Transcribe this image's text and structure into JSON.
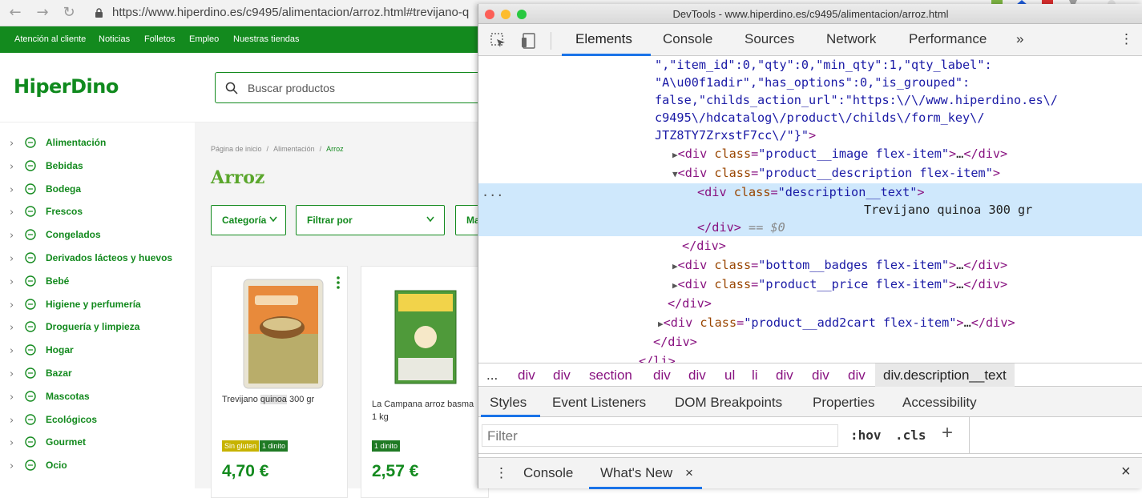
{
  "browser": {
    "url": "https://www.hiperdino.es/c9495/alimentacion/arroz.html#trevijano-q"
  },
  "site": {
    "topnav": [
      "Atención al cliente",
      "Noticias",
      "Folletos",
      "Empleo",
      "Nuestras tiendas"
    ],
    "logo": "HiperDino",
    "search_placeholder": "Buscar productos",
    "sidebar": [
      "Alimentación",
      "Bebidas",
      "Bodega",
      "Frescos",
      "Congelados",
      "Derivados lácteos y huevos",
      "Bebé",
      "Higiene y perfumería",
      "Droguería y limpieza",
      "Hogar",
      "Bazar",
      "Mascotas",
      "Ecológicos",
      "Gourmet",
      "Ocio"
    ],
    "breadcrumb": {
      "home": "Página de inicio",
      "sep": "/",
      "cat": "Alimentación",
      "current": "Arroz"
    },
    "page_title": "Arroz",
    "filters": {
      "categoria": "Categoría",
      "filtrar": "Filtrar por",
      "mas": "Ma"
    },
    "products": [
      {
        "name_pre": "Trevijano ",
        "name_hl": "quinoa",
        "name_post": " 300 gr",
        "badge1": "Sin gluten",
        "badge2": "1 dinito",
        "price": "4,70 €"
      },
      {
        "name_line1": "La Campana arroz basma",
        "name_line2": "1 kg",
        "badge1": "1 dinito",
        "price": "2,57 €"
      }
    ],
    "colors": {
      "brand_green": "#138a1e",
      "title_green": "#5aa62c",
      "badge_yellow": "#c7b300",
      "badge_green": "#1f7a24"
    }
  },
  "devtools": {
    "window_title": "DevTools - www.hiperdino.es/c9495/alimentacion/arroz.html",
    "tabs": [
      "Elements",
      "Console",
      "Sources",
      "Network",
      "Performance"
    ],
    "more_tabs": "»",
    "code": {
      "l1": "\",\"item_id\":0,\"qty\":0,\"min_qty\":1,\"qty_label\":",
      "l2": "\"A\\u00f1adir\",\"has_options\":0,\"is_grouped\":",
      "l3": "false,\"childs_action_url\":\"https:\\/\\/www.hiperdino.es\\/",
      "l4": "c9495\\/hdcatalog\\/product\\/childs\\/form_key\\/",
      "l5a": "JTZ8TY7ZrxstF7cc\\/\"}\"",
      "l5b": ">",
      "div": "div",
      "class": "class",
      "c_image": "\"product__image flex-item\"",
      "c_desc": "\"product__description flex-item\"",
      "c_text": "\"description__text\"",
      "text_node": "Trevijano quinoa 300 gr",
      "eq": "== $0",
      "c_badges": "\"bottom__badges flex-item\"",
      "c_price": "\"product__price flex-item\"",
      "c_add": "\"product__add2cart flex-item\"",
      "ellipsis": "…",
      "li": "li"
    },
    "crumbs": [
      "...",
      "div",
      "div",
      "section",
      "div",
      "div",
      "ul",
      "li",
      "div",
      "div",
      "div",
      "div.description__text"
    ],
    "subtabs": [
      "Styles",
      "Event Listeners",
      "DOM Breakpoints",
      "Properties",
      "Accessibility"
    ],
    "filter_placeholder": "Filter",
    "hov": ":hov",
    "cls": ".cls",
    "plus": "+",
    "drawer_tabs": [
      "Console",
      "What's New"
    ],
    "close_x": "×",
    "drawer_close": "×",
    "dots": "⋮",
    "sel_dots": "..."
  }
}
